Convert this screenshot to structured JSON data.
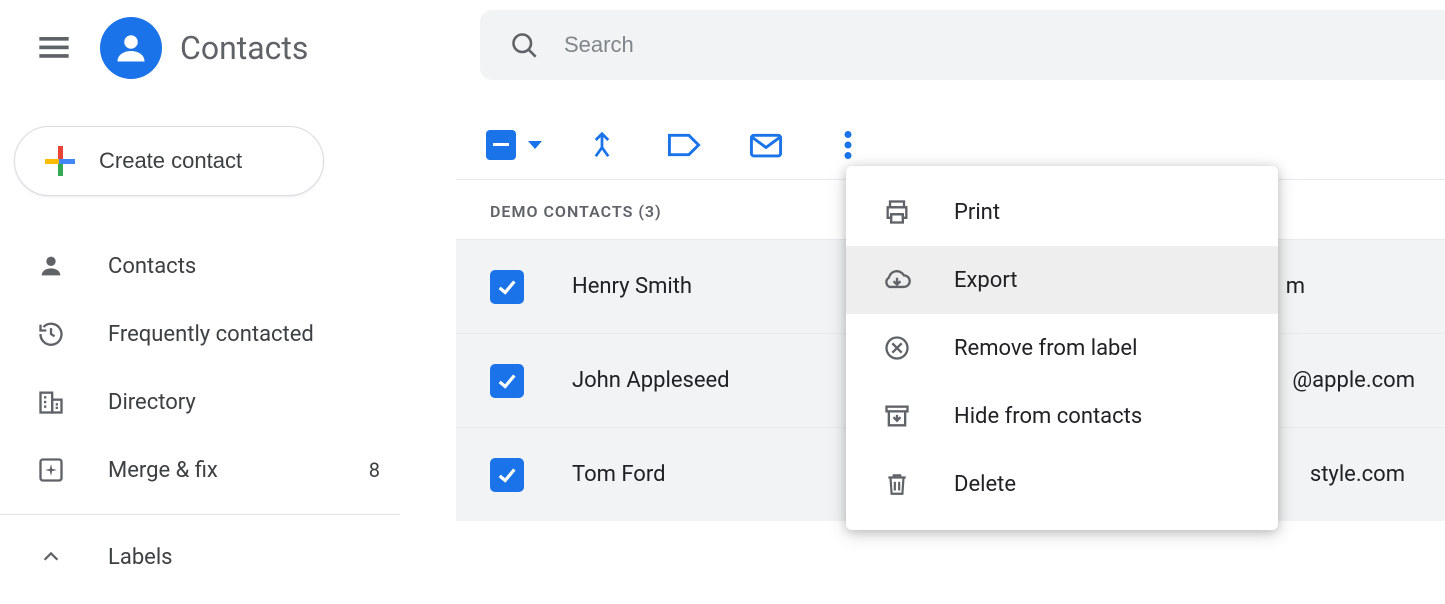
{
  "header": {
    "app_title": "Contacts",
    "search_placeholder": "Search"
  },
  "sidebar": {
    "create_label": "Create contact",
    "nav": [
      {
        "label": "Contacts"
      },
      {
        "label": "Frequently contacted"
      },
      {
        "label": "Directory"
      },
      {
        "label": "Merge & fix",
        "badge": "8"
      }
    ],
    "labels_header": "Labels"
  },
  "main": {
    "group_header": "DEMO CONTACTS (3)",
    "contacts": [
      {
        "name": "Henry Smith",
        "email_fragment": "m"
      },
      {
        "name": "John Appleseed",
        "email_fragment": "@apple.com"
      },
      {
        "name": "Tom Ford",
        "email_fragment": "style.com"
      }
    ]
  },
  "dropdown": {
    "items": [
      {
        "label": "Print"
      },
      {
        "label": "Export"
      },
      {
        "label": "Remove from label"
      },
      {
        "label": "Hide from contacts"
      },
      {
        "label": "Delete"
      }
    ]
  },
  "colors": {
    "primary": "#1a73e8",
    "text_secondary": "#5f6368"
  }
}
